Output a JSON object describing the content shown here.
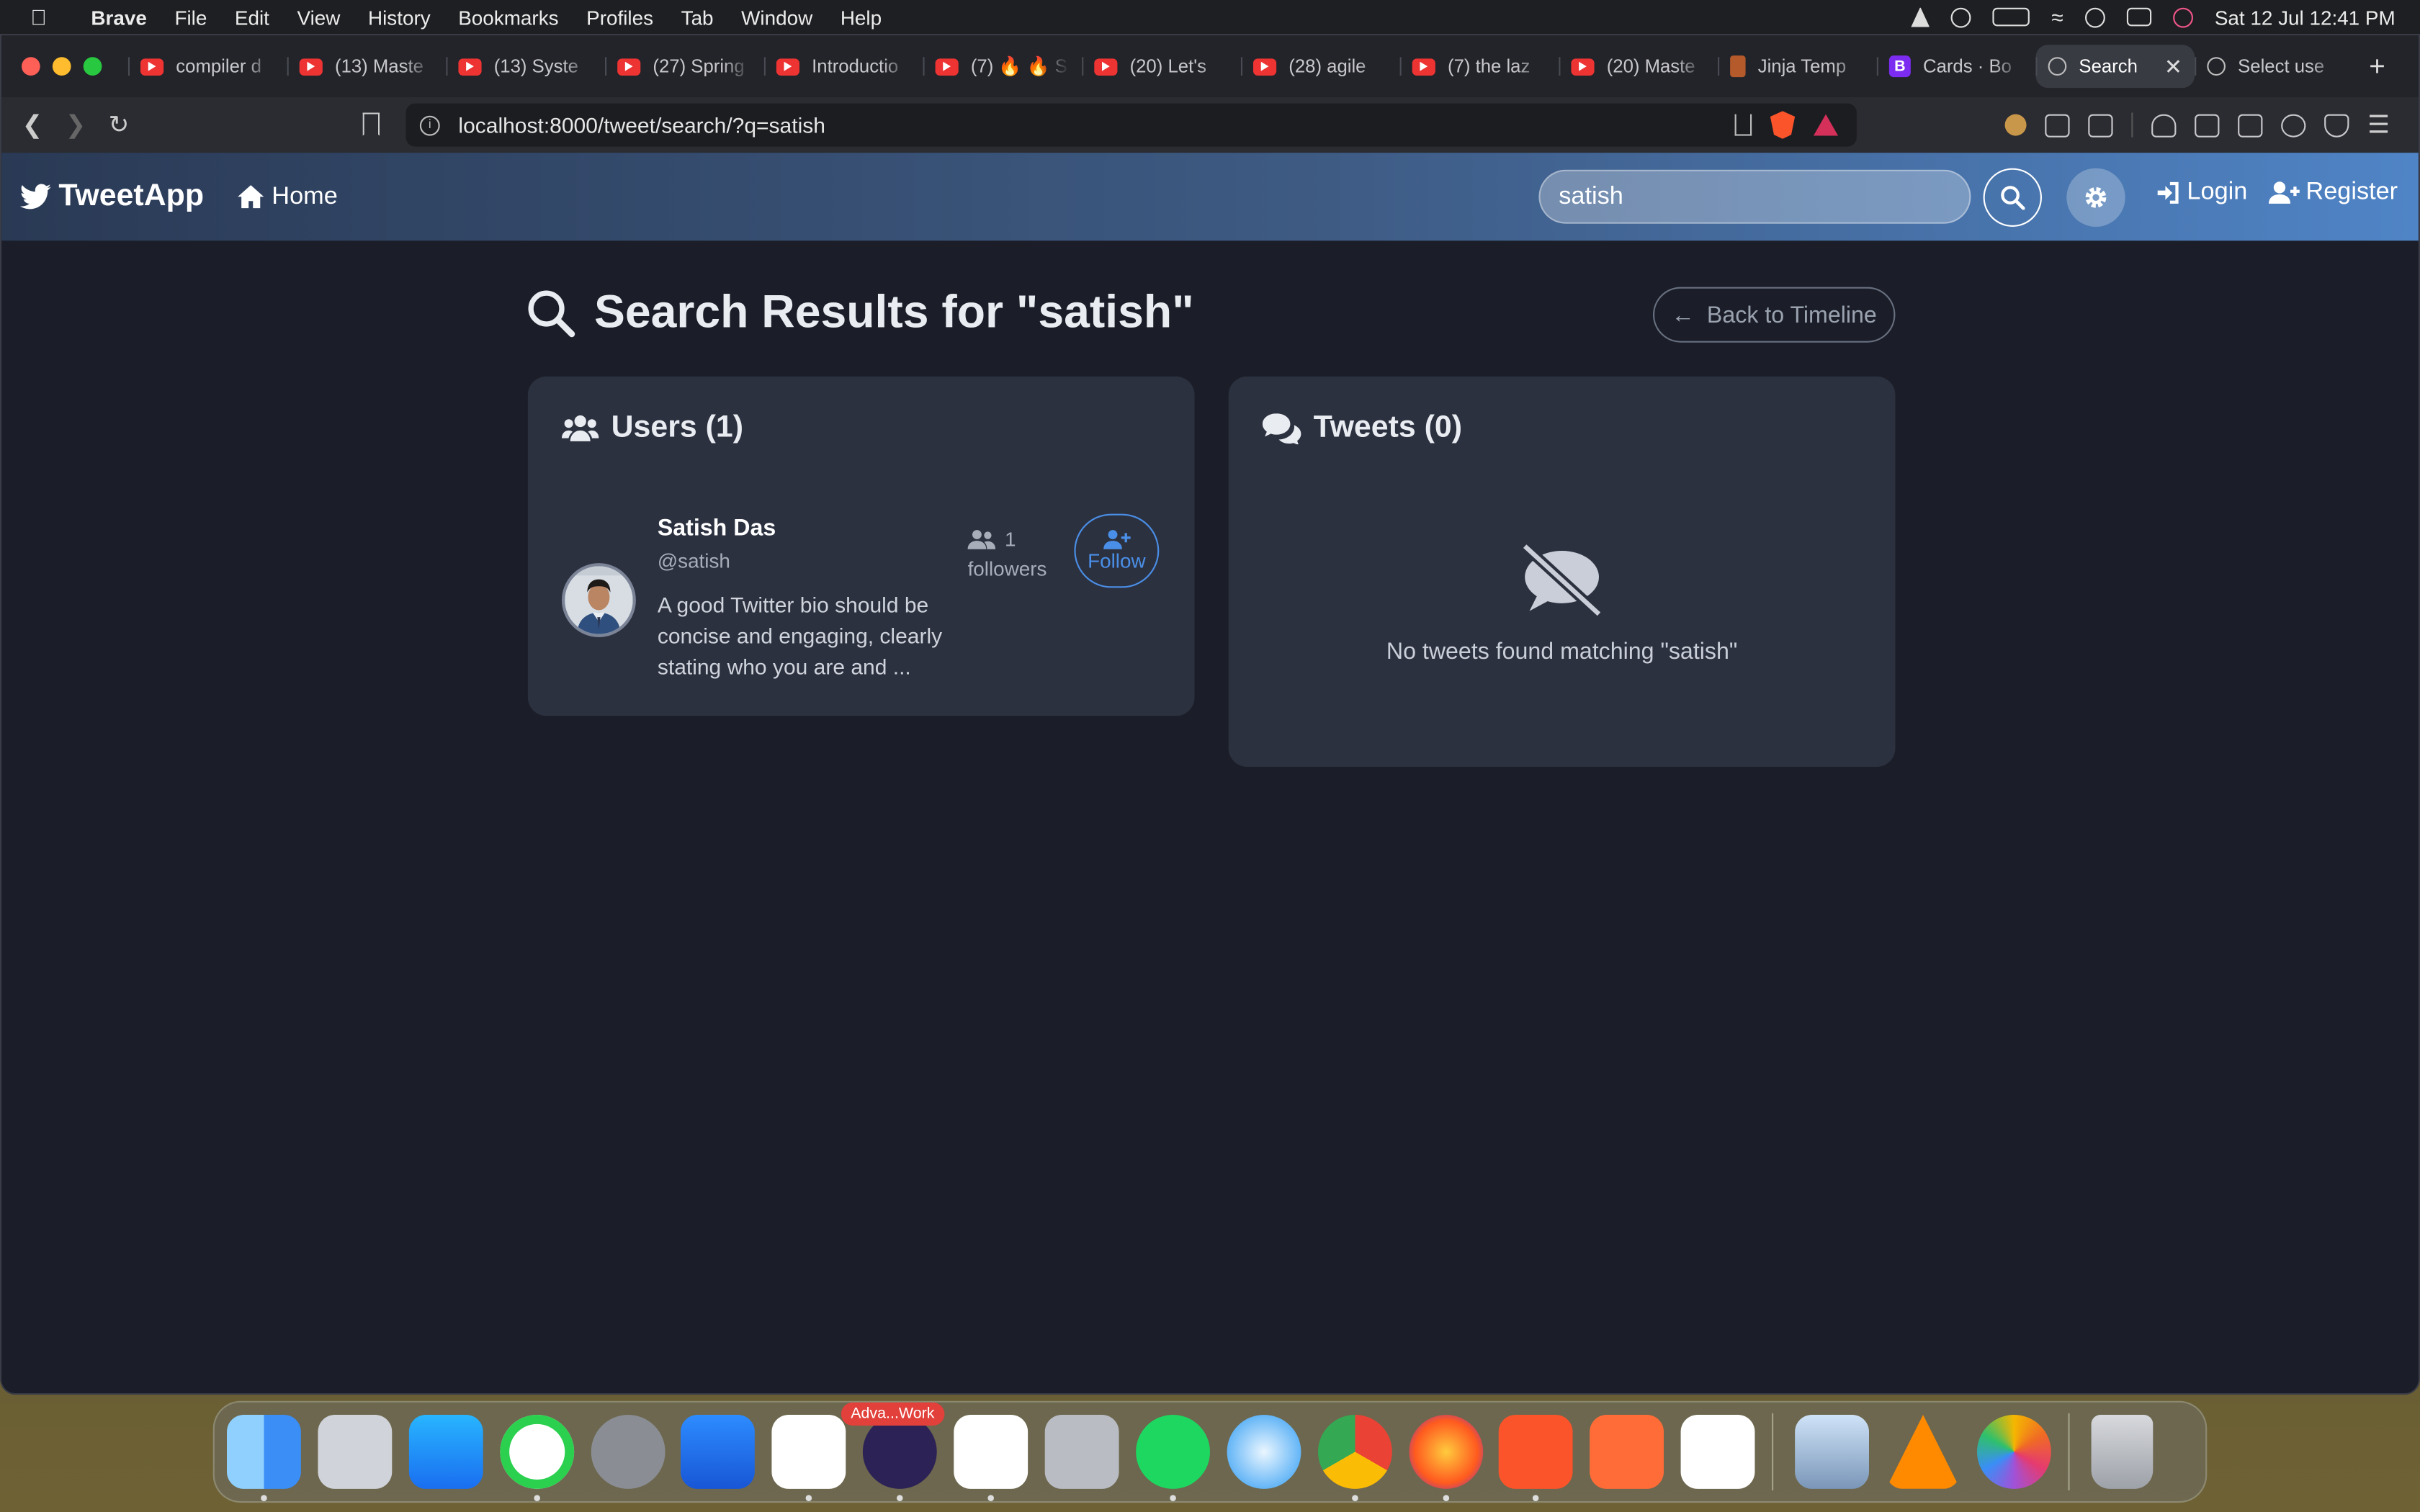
{
  "menubar": {
    "app_name": "Brave",
    "items": [
      "File",
      "Edit",
      "View",
      "History",
      "Bookmarks",
      "Profiles",
      "Tab",
      "Window",
      "Help"
    ],
    "clock": "Sat 12 Jul  12:41 PM"
  },
  "tabs": [
    {
      "title": "compiler d",
      "icon": "youtube-icon"
    },
    {
      "title": "(13) Maste",
      "icon": "youtube-icon"
    },
    {
      "title": "(13) Syste",
      "icon": "youtube-icon"
    },
    {
      "title": "(27) Spring",
      "icon": "youtube-icon"
    },
    {
      "title": "Introductio",
      "icon": "youtube-icon"
    },
    {
      "title": "(7) 🔥 🔥 S",
      "icon": "youtube-icon"
    },
    {
      "title": "(20) Let's",
      "icon": "youtube-icon"
    },
    {
      "title": "(28) agile",
      "icon": "youtube-icon"
    },
    {
      "title": "(7) the laz",
      "icon": "youtube-icon"
    },
    {
      "title": "(20) Maste",
      "icon": "youtube-icon"
    },
    {
      "title": "Jinja Temp",
      "icon": "jinja-icon"
    },
    {
      "title": "Cards · Bo",
      "icon": "bootstrap-icon"
    },
    {
      "title": "Search",
      "icon": "globe-icon",
      "active": true
    },
    {
      "title": "Select use",
      "icon": "globe-icon"
    }
  ],
  "address": {
    "url": "localhost:8000/tweet/search/?q=satish",
    "brave_badge": "1"
  },
  "navbar": {
    "brand": "TweetApp",
    "home": "Home",
    "search_value": "satish",
    "login": "Login",
    "register": "Register"
  },
  "page": {
    "title": "Search Results for \"satish\"",
    "back": "Back to Timeline",
    "users_heading": "Users (1)",
    "tweets_heading": "Tweets (0)",
    "user": {
      "name": "Satish Das",
      "handle": "@satish",
      "bio": "A good Twitter bio should be concise and engaging, clearly stating who you are and ...",
      "followers_count": "1",
      "followers_label": "followers",
      "follow_label": "Follow"
    },
    "no_tweets": "No tweets found matching \"satish\""
  },
  "dock": {
    "apps": [
      "finder",
      "launchpad",
      "app-store",
      "whatsapp",
      "system-settings",
      "xcode",
      "vscode",
      "eclipse",
      "warp",
      "parallels",
      "spotify",
      "safari",
      "chrome",
      "firefox",
      "brave",
      "postman",
      "mongodb-compass",
      "preview",
      "vlc",
      "photos",
      "trash"
    ],
    "badge_text": "Adva...Work"
  },
  "colors": {
    "accent": "#4a8fe7",
    "navbar_start": "#2a3a55",
    "navbar_end": "#4f84c6",
    "page_bg": "#1b1e28",
    "card_bg": "#2c3140"
  }
}
